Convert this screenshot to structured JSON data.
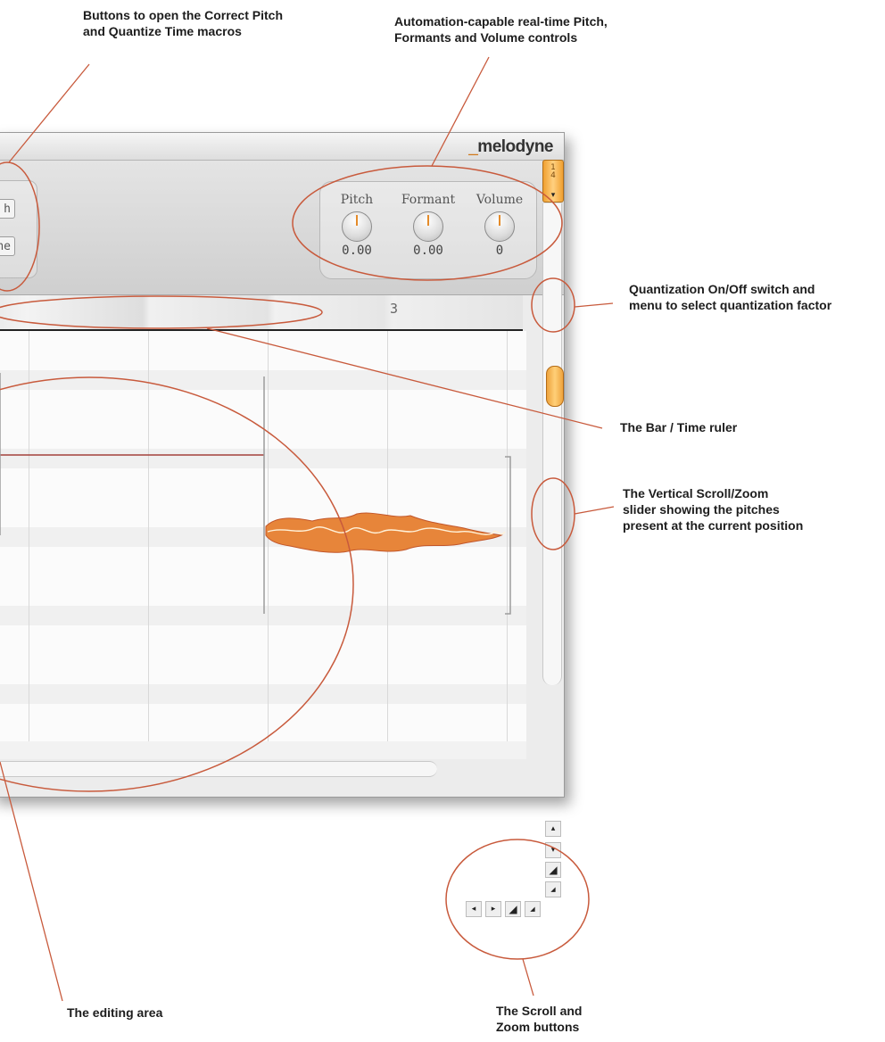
{
  "callouts": {
    "macros": [
      "Buttons to open the Correct Pitch",
      "and Quantize Time macros"
    ],
    "automation": [
      "Automation-capable real-time Pitch,",
      "Formants and Volume controls"
    ],
    "quantization": [
      "Quantization On/Off switch and",
      "menu to select quantization factor"
    ],
    "ruler": [
      "The Bar / Time ruler"
    ],
    "vscroll": [
      "The Vertical Scroll/Zoom",
      "slider showing the pitches",
      "present at the current position"
    ],
    "editing": [
      "The editing area"
    ],
    "scroll_zoom": [
      "The Scroll and",
      "Zoom buttons"
    ]
  },
  "app": {
    "logo": "melodyne",
    "macro_buttons": [
      {
        "label": "h"
      },
      {
        "label": "ne"
      }
    ],
    "knobs": [
      {
        "label": "Pitch",
        "value": "0.00"
      },
      {
        "label": "Formant",
        "value": "0.00"
      },
      {
        "label": "Volume",
        "value": "0"
      }
    ],
    "ruler": {
      "bar_number": "3"
    },
    "quantize": {
      "numerator": "1",
      "denominator": "4",
      "arrow": "▾"
    },
    "scroll_buttons": {
      "v_up": "▴",
      "v_down": "▾",
      "v_zoom_in": "◢",
      "v_zoom_out": "◢",
      "h_left": "◂",
      "h_right": "▸",
      "h_zoom_in": "◢",
      "h_zoom_out": "◢"
    }
  },
  "colors": {
    "accent": "#e48b2a",
    "callout_line": "#c85a3c",
    "blob_fill": "#e7853a"
  }
}
